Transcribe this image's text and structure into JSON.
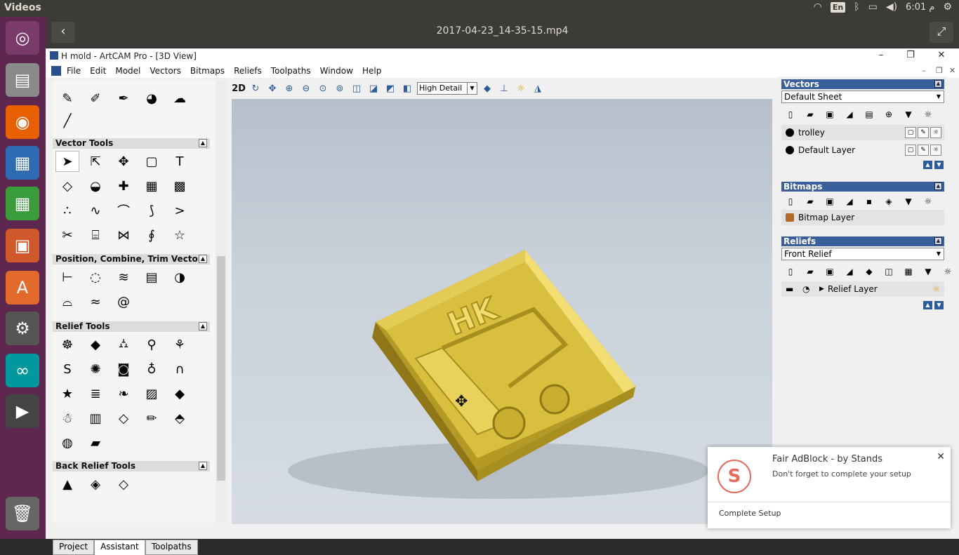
{
  "topbar": {
    "app_title": "Videos",
    "lang": "En",
    "time": "6:01 م"
  },
  "launcher": {
    "items": [
      "ubuntu-logo-icon",
      "files-icon",
      "firefox-icon",
      "writer-icon",
      "calc-icon",
      "impress-icon",
      "software-center-icon",
      "settings-icon",
      "arduino-icon",
      "video-editor-icon",
      "trash-icon"
    ]
  },
  "video": {
    "title": "2017-04-23_14-35-15.mp4"
  },
  "window": {
    "title": "H mold - ArtCAM Pro - [3D View]",
    "menus": [
      "File",
      "Edit",
      "Model",
      "Vectors",
      "Bitmaps",
      "Reliefs",
      "Toolpaths",
      "Window",
      "Help"
    ]
  },
  "left": {
    "sections": [
      "Vector Tools",
      "Position, Combine, Trim Vectors",
      "Relief Tools",
      "Back Relief Tools"
    ],
    "tabs": [
      "Project",
      "Assistant",
      "Toolpaths"
    ]
  },
  "viewtoolbar": {
    "mode": "2D",
    "detail": "High Detail"
  },
  "right": {
    "vectors": {
      "title": "Vectors",
      "sheet": "Default Sheet",
      "layers": [
        "trolley",
        "Default Layer"
      ]
    },
    "bitmaps": {
      "title": "Bitmaps",
      "layer": "Bitmap Layer"
    },
    "reliefs": {
      "title": "Reliefs",
      "relief": "Front Relief",
      "layer": "Relief Layer"
    }
  },
  "toast": {
    "title": "Fair AdBlock - by Stands",
    "message": "Don't forget to complete your setup",
    "action": "Complete Setup"
  },
  "model": {
    "label": "HK",
    "colors": {
      "body": "#d8bf3e",
      "shadow": "#a88d1f",
      "highlight": "#f0dc6c"
    }
  }
}
